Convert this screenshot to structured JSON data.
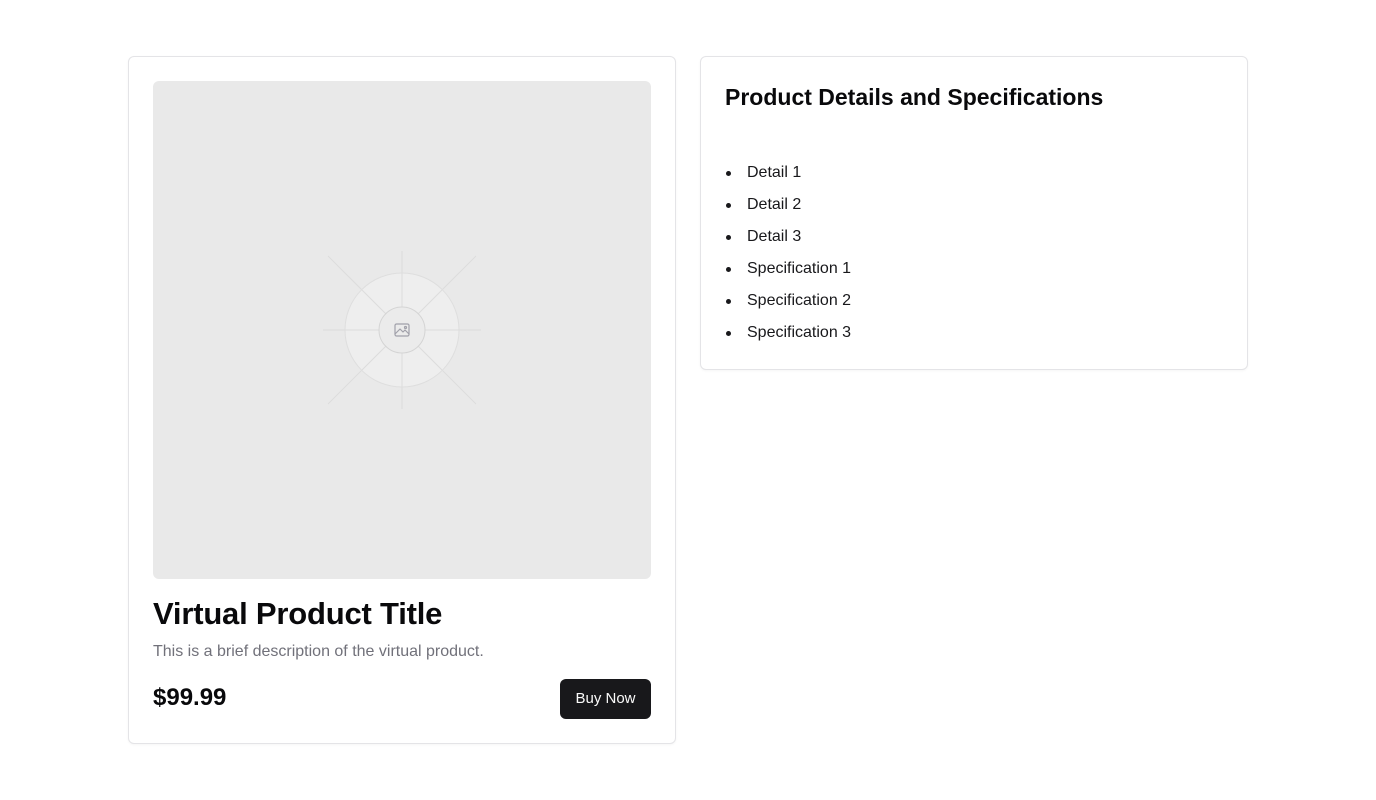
{
  "product": {
    "image_icon": "image-placeholder-icon",
    "title": "Virtual Product Title",
    "description": "This is a brief description of the virtual product.",
    "price": "$99.99",
    "buy_label": "Buy Now"
  },
  "details": {
    "title": "Product Details and Specifications",
    "items": [
      "Detail 1",
      "Detail 2",
      "Detail 3",
      "Specification 1",
      "Specification 2",
      "Specification 3"
    ]
  },
  "colors": {
    "background": "#ffffff",
    "card_border": "#e4e4e7",
    "image_placeholder": "#e9e9e9",
    "text_primary": "#09090b",
    "text_muted": "#71717a",
    "button_bg": "#18181b",
    "button_text": "#fafafa"
  }
}
